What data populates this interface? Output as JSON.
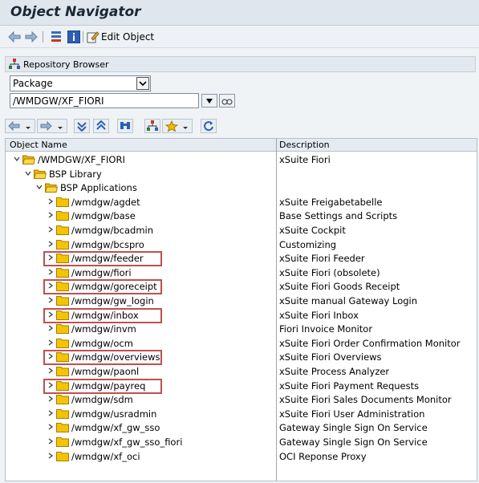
{
  "window": {
    "title": "Object Navigator"
  },
  "toolbar": {
    "edit_object_label": "Edit Object"
  },
  "repository": {
    "header_label": "Repository Browser",
    "object_type": "Package",
    "object_path": "/WMDGW/XF_FIORI"
  },
  "grid": {
    "col_name": "Object Name",
    "col_desc": "Description",
    "rows": [
      {
        "level": 0,
        "name": "/WMDGW/XF_FIORI",
        "desc": "xSuite Fiori",
        "expanded": true,
        "highlight": false
      },
      {
        "level": 1,
        "name": "BSP Library",
        "desc": "",
        "expanded": true,
        "highlight": false
      },
      {
        "level": 2,
        "name": "BSP Applications",
        "desc": "",
        "expanded": true,
        "highlight": false
      },
      {
        "level": 3,
        "name": "/wmdgw/agdet",
        "desc": "xSuite Freigabetabelle",
        "expanded": false,
        "highlight": false
      },
      {
        "level": 3,
        "name": "/wmdgw/base",
        "desc": "Base Settings and Scripts",
        "expanded": false,
        "highlight": false
      },
      {
        "level": 3,
        "name": "/wmdgw/bcadmin",
        "desc": "xSuite Cockpit",
        "expanded": false,
        "highlight": false
      },
      {
        "level": 3,
        "name": "/wmdgw/bcspro",
        "desc": "Customizing",
        "expanded": false,
        "highlight": false
      },
      {
        "level": 3,
        "name": "/wmdgw/feeder",
        "desc": "xSuite Fiori Feeder",
        "expanded": false,
        "highlight": true
      },
      {
        "level": 3,
        "name": "/wmdgw/fiori",
        "desc": "xSuite Fiori (obsolete)",
        "expanded": false,
        "highlight": false
      },
      {
        "level": 3,
        "name": "/wmdgw/goreceipt",
        "desc": "xSuite Fiori Goods Receipt",
        "expanded": false,
        "highlight": true
      },
      {
        "level": 3,
        "name": "/wmdgw/gw_login",
        "desc": "xSuite manual Gateway Login",
        "expanded": false,
        "highlight": false
      },
      {
        "level": 3,
        "name": "/wmdgw/inbox",
        "desc": "xSuite Fiori Inbox",
        "expanded": false,
        "highlight": true
      },
      {
        "level": 3,
        "name": "/wmdgw/invm",
        "desc": "Fiori Invoice Monitor",
        "expanded": false,
        "highlight": false
      },
      {
        "level": 3,
        "name": "/wmdgw/ocm",
        "desc": "xSuite Fiori Order Confirmation Monitor",
        "expanded": false,
        "highlight": false
      },
      {
        "level": 3,
        "name": "/wmdgw/overviews",
        "desc": "xSuite Fiori Overviews",
        "expanded": false,
        "highlight": true
      },
      {
        "level": 3,
        "name": "/wmdgw/paonl",
        "desc": "xSuite Process Analyzer",
        "expanded": false,
        "highlight": false
      },
      {
        "level": 3,
        "name": "/wmdgw/payreq",
        "desc": "xSuite Fiori Payment Requests",
        "expanded": false,
        "highlight": true
      },
      {
        "level": 3,
        "name": "/wmdgw/sdm",
        "desc": "xSuite Fiori Sales Documents Monitor",
        "expanded": false,
        "highlight": false
      },
      {
        "level": 3,
        "name": "/wmdgw/usradmin",
        "desc": "xSuite Fiori User Administration",
        "expanded": false,
        "highlight": false
      },
      {
        "level": 3,
        "name": "/wmdgw/xf_gw_sso",
        "desc": "Gateway Single Sign On Service",
        "expanded": false,
        "highlight": false
      },
      {
        "level": 3,
        "name": "/wmdgw/xf_gw_sso_fiori",
        "desc": "Gateway Single Sign On Service",
        "expanded": false,
        "highlight": false
      },
      {
        "level": 3,
        "name": "/wmdgw/xf_oci",
        "desc": "OCI Reponse Proxy",
        "expanded": false,
        "highlight": false
      }
    ]
  },
  "icons": {
    "back": "arrow-left-icon",
    "forward": "arrow-right-icon",
    "hierarchy": "hierarchy-icon",
    "info": "info-icon",
    "edit": "edit-object-icon",
    "repository": "repository-browser-icon",
    "folder": "folder-icon"
  },
  "colors": {
    "highlight_border": "#c0504d",
    "folder": "#f5c400"
  }
}
